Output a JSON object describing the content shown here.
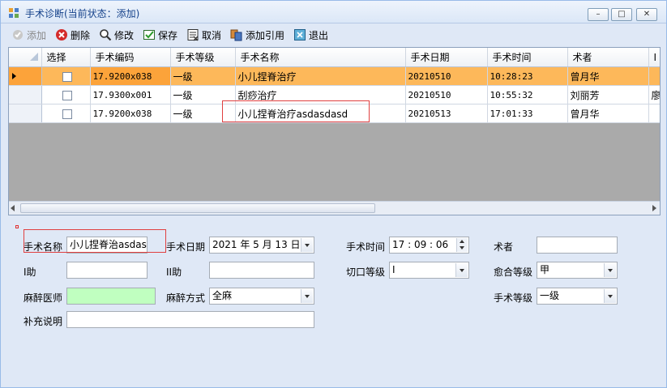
{
  "window": {
    "title": "手术诊断(当前状态：添加)",
    "controls": {
      "minimize": "–",
      "maximize": "□",
      "close": "✕"
    }
  },
  "toolbar": {
    "add": "添加",
    "delete": "删除",
    "edit": "修改",
    "save": "保存",
    "cancel": "取消",
    "add_ref": "添加引用",
    "exit": "退出"
  },
  "grid": {
    "columns": [
      "选择",
      "手术编码",
      "手术等级",
      "手术名称",
      "手术日期",
      "手术时间",
      "术者",
      "I"
    ],
    "rows": [
      {
        "selected": true,
        "code": "17.9200x038",
        "level": "一级",
        "name": "小儿捏脊治疗",
        "date": "20210510",
        "time": "10:28:23",
        "surgeon": "曾月华",
        "extra": ""
      },
      {
        "selected": false,
        "code": "17.9300x001",
        "level": "一级",
        "name": "刮痧治疗",
        "date": "20210510",
        "time": "10:55:32",
        "surgeon": "刘丽芳",
        "extra": "廖"
      },
      {
        "selected": false,
        "code": "17.9200x038",
        "level": "一级",
        "name": "小儿捏脊治疗asdasdasd",
        "date": "20210513",
        "time": "17:01:33",
        "surgeon": "曾月华",
        "extra": ""
      }
    ]
  },
  "form": {
    "surgery_name_label": "手术名称",
    "surgery_name_value": "小儿捏脊治asdasd",
    "surgery_date_label": "手术日期",
    "surgery_date_value": "2021 年 5 月 13 日",
    "surgery_time_label": "手术时间",
    "surgery_time_value": "17 : 09 : 06",
    "surgeon_label": "术者",
    "surgeon_value": "",
    "assist1_label": "I助",
    "assist1_value": "",
    "assist2_label": "II助",
    "assist2_value": "",
    "incision_label": "切口等级",
    "incision_value": "I",
    "healing_label": "愈合等级",
    "healing_value": "甲",
    "anesthetist_label": "麻醉医师",
    "anesthetist_value": "",
    "anesthesia_method_label": "麻醉方式",
    "anesthesia_method_value": "全麻",
    "surgery_level_label": "手术等级",
    "surgery_level_value": "一级",
    "notes_label": "补充说明",
    "notes_value": ""
  },
  "colors": {
    "selected_row": "#fdb85a",
    "anesthetist_field": "#c0ffc0",
    "annotation_red": "#e04040"
  }
}
